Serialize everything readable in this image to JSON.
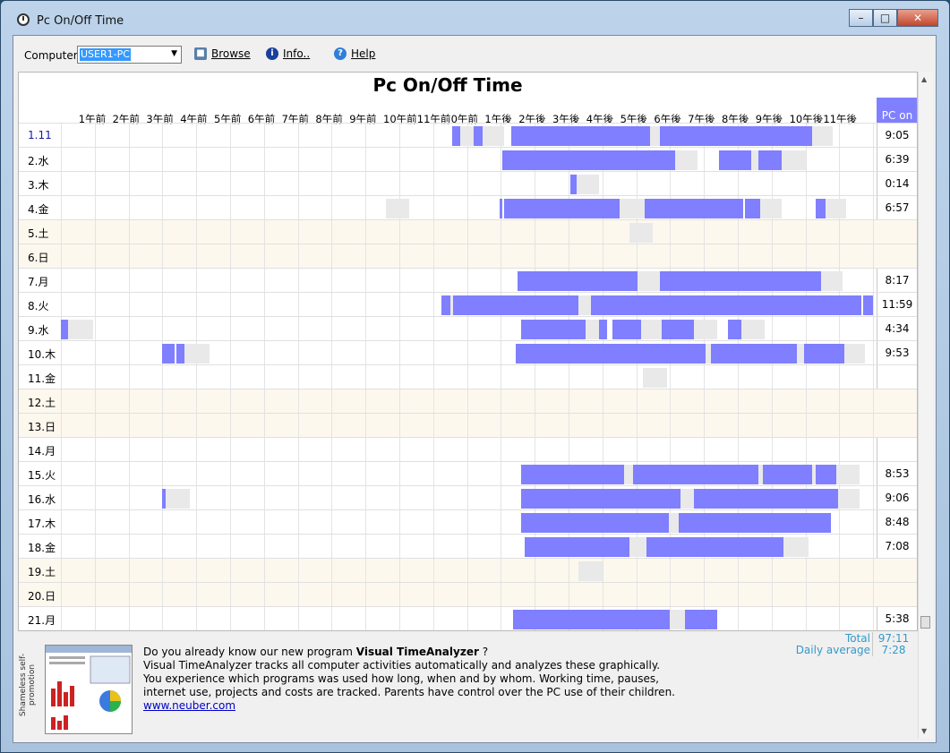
{
  "window": {
    "title": "Pc On/Off Time"
  },
  "toolbar": {
    "computer_label": "Computer",
    "computer_value": "USER1-PC",
    "browse_label": "Browse",
    "info_label": "Info..",
    "help_label": "Help"
  },
  "chart_data": {
    "type": "gantt",
    "title": "Pc On/Off Time",
    "x_unit": "hour",
    "x_range": [
      0,
      24
    ],
    "hours": [
      "1午前",
      "2午前",
      "3午前",
      "4午前",
      "5午前",
      "6午前",
      "7午前",
      "8午前",
      "9午前",
      "10午前",
      "11午前",
      "0午前",
      "1午後",
      "2午後",
      "3午後",
      "4午後",
      "5午後",
      "6午後",
      "7午後",
      "8午後",
      "9午後",
      "10午後",
      "11午後"
    ],
    "pc_on_header": "PC on",
    "rows": [
      {
        "label": "1.11",
        "weekend": false,
        "today": true,
        "pc_on": "9:05",
        "intervals": [
          [
            11.55,
            11.8
          ],
          [
            12.2,
            12.45
          ],
          [
            13.3,
            17.4
          ],
          [
            17.7,
            22.2
          ]
        ],
        "gaps": [
          [
            11.8,
            12.2
          ],
          [
            12.45,
            13.1
          ],
          [
            17.4,
            17.7
          ],
          [
            22.2,
            22.8
          ]
        ]
      },
      {
        "label": "2.水",
        "weekend": false,
        "pc_on": "6:39",
        "intervals": [
          [
            13.05,
            18.15
          ],
          [
            19.45,
            20.4
          ],
          [
            20.6,
            21.3
          ]
        ],
        "gaps": [
          [
            18.15,
            18.8
          ],
          [
            20.4,
            20.6
          ],
          [
            21.3,
            22.0
          ]
        ]
      },
      {
        "label": "3.木",
        "weekend": false,
        "pc_on": "0:14",
        "intervals": [
          [
            15.05,
            15.25
          ]
        ],
        "gaps": [
          [
            15.25,
            15.9
          ]
        ]
      },
      {
        "label": "4.金",
        "weekend": false,
        "pc_on": "6:57",
        "intervals": [
          [
            12.95,
            13.05
          ],
          [
            13.1,
            16.5
          ],
          [
            17.25,
            20.15
          ],
          [
            20.2,
            20.65
          ],
          [
            22.3,
            22.6
          ]
        ],
        "gaps": [
          [
            9.6,
            10.3
          ],
          [
            16.5,
            17.25
          ],
          [
            20.65,
            21.3
          ],
          [
            22.6,
            23.2
          ]
        ]
      },
      {
        "label": "5.土",
        "weekend": true,
        "pc_on": "",
        "intervals": [],
        "gaps": [
          [
            16.8,
            17.5
          ]
        ]
      },
      {
        "label": "6.日",
        "weekend": true,
        "pc_on": "",
        "intervals": [],
        "gaps": []
      },
      {
        "label": "7.月",
        "weekend": false,
        "pc_on": "8:17",
        "intervals": [
          [
            13.5,
            17.05
          ],
          [
            17.7,
            22.45
          ]
        ],
        "gaps": [
          [
            17.05,
            17.7
          ],
          [
            22.45,
            23.1
          ]
        ]
      },
      {
        "label": "8.火",
        "weekend": false,
        "pc_on": "11:59",
        "intervals": [
          [
            11.25,
            11.5
          ],
          [
            11.6,
            15.3
          ],
          [
            15.65,
            23.65
          ],
          [
            23.7,
            24.0
          ]
        ],
        "gaps": [
          [
            11.5,
            11.6
          ],
          [
            15.3,
            15.65
          ]
        ]
      },
      {
        "label": "9.水",
        "weekend": false,
        "pc_on": "4:34",
        "intervals": [
          [
            0.0,
            0.2
          ],
          [
            13.6,
            15.5
          ],
          [
            15.9,
            16.15
          ],
          [
            16.3,
            17.15
          ],
          [
            17.75,
            18.7
          ],
          [
            19.7,
            20.1
          ]
        ],
        "gaps": [
          [
            0.2,
            0.95
          ],
          [
            15.5,
            15.9
          ],
          [
            17.15,
            17.75
          ],
          [
            18.7,
            19.4
          ],
          [
            20.1,
            20.8
          ]
        ]
      },
      {
        "label": "10.木",
        "weekend": false,
        "pc_on": "9:53",
        "intervals": [
          [
            3.0,
            3.35
          ],
          [
            3.4,
            3.65
          ],
          [
            13.45,
            19.05
          ],
          [
            19.2,
            21.75
          ],
          [
            21.95,
            23.15
          ]
        ],
        "gaps": [
          [
            3.65,
            4.4
          ],
          [
            19.05,
            19.2
          ],
          [
            21.75,
            21.95
          ],
          [
            23.15,
            23.75
          ]
        ]
      },
      {
        "label": "11.金",
        "weekend": false,
        "pc_on": "",
        "intervals": [],
        "gaps": [
          [
            17.2,
            17.9
          ]
        ]
      },
      {
        "label": "12.土",
        "weekend": true,
        "pc_on": "",
        "intervals": [],
        "gaps": []
      },
      {
        "label": "13.日",
        "weekend": true,
        "pc_on": "",
        "intervals": [],
        "gaps": []
      },
      {
        "label": "14.月",
        "weekend": false,
        "pc_on": "",
        "intervals": [],
        "gaps": []
      },
      {
        "label": "15.火",
        "weekend": false,
        "pc_on": "8:53",
        "intervals": [
          [
            13.6,
            16.65
          ],
          [
            16.9,
            20.6
          ],
          [
            20.75,
            22.2
          ],
          [
            22.3,
            22.9
          ]
        ],
        "gaps": [
          [
            16.65,
            16.9
          ],
          [
            20.6,
            20.75
          ],
          [
            22.2,
            22.3
          ],
          [
            22.9,
            23.6
          ]
        ]
      },
      {
        "label": "16.水",
        "weekend": false,
        "pc_on": "9:06",
        "intervals": [
          [
            3.0,
            3.1
          ],
          [
            13.6,
            18.3
          ],
          [
            18.7,
            22.95
          ]
        ],
        "gaps": [
          [
            3.1,
            3.8
          ],
          [
            18.3,
            18.7
          ],
          [
            22.95,
            23.6
          ]
        ]
      },
      {
        "label": "17.木",
        "weekend": false,
        "pc_on": "8:48",
        "intervals": [
          [
            13.6,
            17.95
          ],
          [
            18.25,
            22.75
          ]
        ],
        "gaps": [
          [
            17.95,
            18.25
          ]
        ]
      },
      {
        "label": "18.金",
        "weekend": false,
        "pc_on": "7:08",
        "intervals": [
          [
            13.7,
            16.8
          ],
          [
            17.3,
            21.35
          ]
        ],
        "gaps": [
          [
            16.8,
            17.3
          ],
          [
            21.35,
            22.1
          ]
        ]
      },
      {
        "label": "19.土",
        "weekend": true,
        "pc_on": "",
        "intervals": [],
        "gaps": [
          [
            15.3,
            16.0
          ]
        ]
      },
      {
        "label": "20.日",
        "weekend": true,
        "pc_on": "",
        "intervals": [],
        "gaps": []
      },
      {
        "label": "21.月",
        "weekend": false,
        "pc_on": "5:38",
        "intervals": [
          [
            13.35,
            18.0
          ],
          [
            18.45,
            19.4
          ]
        ],
        "gaps": [
          [
            18.0,
            18.45
          ]
        ]
      }
    ],
    "total_label": "Total",
    "total_value": "97:11",
    "avg_label": "Daily average",
    "avg_value": "7:28"
  },
  "promo": {
    "side_label": "Shameless self-promotion",
    "line1_prefix": "Do you already know our new program ",
    "line1_bold": "Visual TimeAnalyzer",
    "line1_suffix": " ?",
    "line2": "Visual TimeAnalyzer tracks all computer activities automatically and analyzes these graphically.",
    "line3": "You experience which programs was used how long, when and by whom. Working time, pauses,",
    "line4": "internet use, projects and costs are tracked. Parents have control over the PC use of their children.",
    "link": "www.neuber.com"
  },
  "colors": {
    "bar": "#7f7fff",
    "gap": "#e9e9e9",
    "weekend": "#fdf8ee",
    "header": "#8080ff"
  }
}
